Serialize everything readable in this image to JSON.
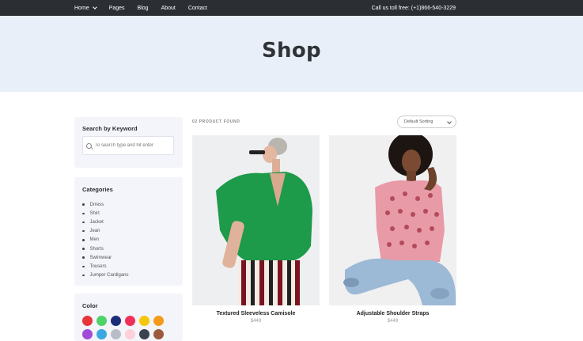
{
  "nav": {
    "items": [
      {
        "label": "Home"
      },
      {
        "label": "Pages"
      },
      {
        "label": "Blog"
      },
      {
        "label": "About"
      },
      {
        "label": "Contact"
      }
    ],
    "phone": "Call us toll free: (+1)866-540-3229"
  },
  "hero": {
    "title": "Shop"
  },
  "sidebar": {
    "search": {
      "title": "Search by Keyword",
      "placeholder": "To search type and hit enter"
    },
    "categories": {
      "title": "Categories",
      "items": [
        "Drress",
        "Shirt",
        "Jacket",
        "Jean",
        "Men",
        "Shorts",
        "Swimwear",
        "Tousers",
        "Jumper Cardigans"
      ]
    },
    "colors": {
      "title": "Color",
      "row1": [
        "#e8353a",
        "#4fd26a",
        "#1c2d7a",
        "#ef2f5c",
        "#f5c70c",
        "#f59a1b"
      ],
      "row2": [
        "#a24bd6",
        "#3aa9e0",
        "#b9bec6",
        "#ffd0d9",
        "#39424e",
        "#9c5a3c"
      ]
    }
  },
  "toolbar": {
    "found": "02 PRODUCT FOUND",
    "sort_label": "Default Sorting"
  },
  "products": [
    {
      "name": "Textured Sleeveless Camisole",
      "price": "$449"
    },
    {
      "name": "Adjustable Shoulder Straps",
      "price": "$449"
    }
  ]
}
